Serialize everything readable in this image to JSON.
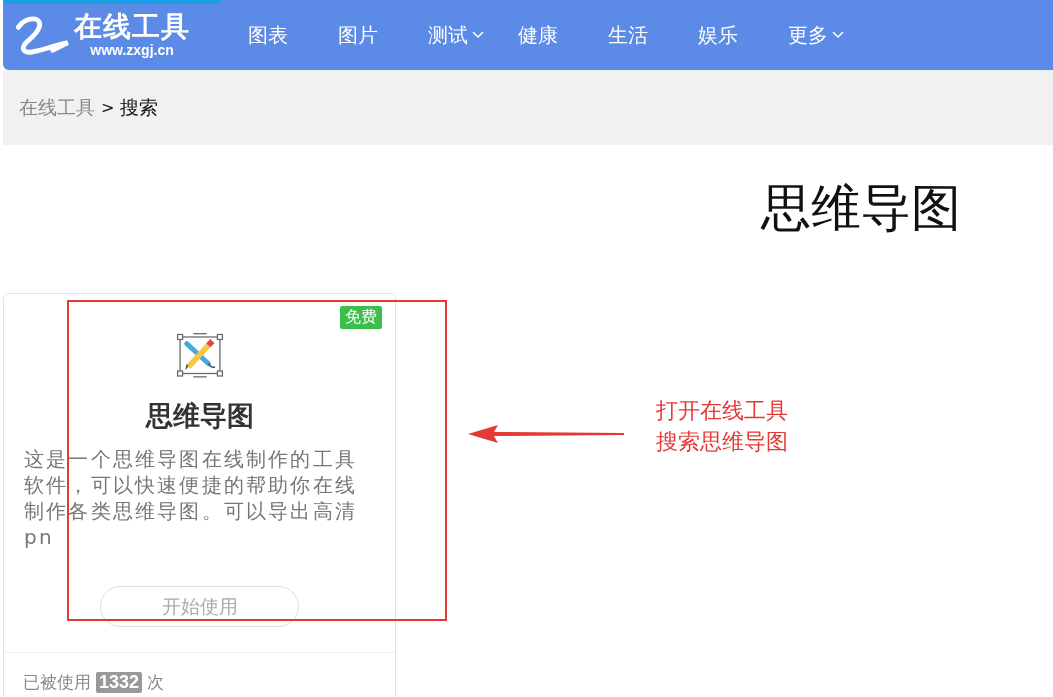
{
  "header": {
    "logo": {
      "title": "在线工具",
      "url": "www.zxgj.cn"
    },
    "nav": [
      {
        "label": "图表",
        "dropdown": false
      },
      {
        "label": "图片",
        "dropdown": false
      },
      {
        "label": "测试",
        "dropdown": true
      },
      {
        "label": "健康",
        "dropdown": false
      },
      {
        "label": "生活",
        "dropdown": false
      },
      {
        "label": "娱乐",
        "dropdown": false
      },
      {
        "label": "更多",
        "dropdown": true
      }
    ]
  },
  "breadcrumb": {
    "items": [
      {
        "label": "在线工具",
        "current": false
      },
      {
        "label": "搜索",
        "current": true
      }
    ],
    "separator": ">"
  },
  "page_title": "思维导图",
  "cards": [
    {
      "badge": "免费",
      "title": "思维导图",
      "description": "这是一个思维导图在线制作的工具软件，可以快速便捷的帮助你在线制作各类思维导图。可以导出高清pn",
      "button": "开始使用",
      "usage": {
        "prefix": "已被使用",
        "count": "1332",
        "suffix": "次"
      }
    }
  ],
  "annotation": {
    "lines": [
      "打开在线工具",
      "搜索思维导图"
    ]
  }
}
